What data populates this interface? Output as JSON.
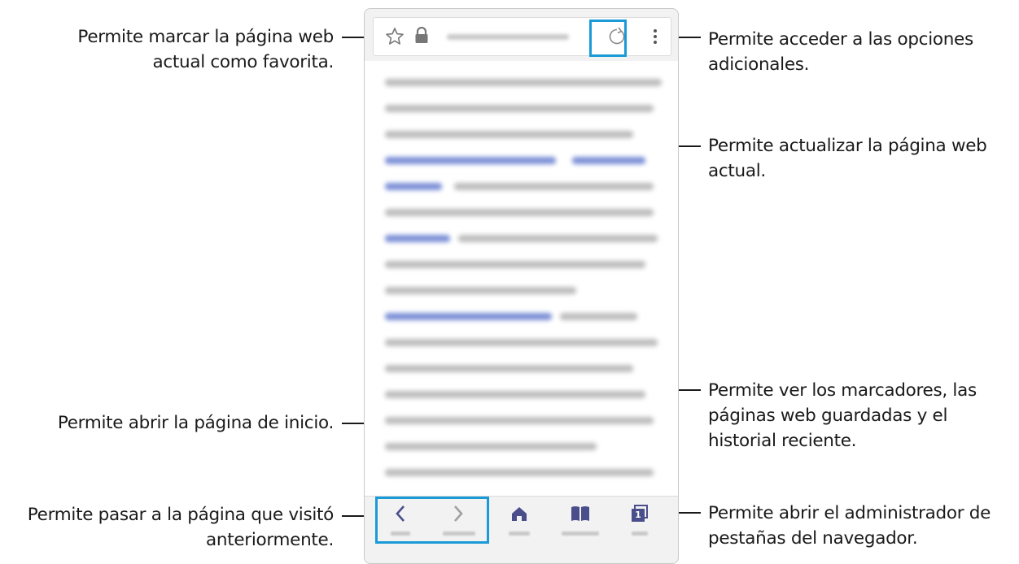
{
  "callouts": {
    "favorite": "Permite marcar la página web actual como favorita.",
    "options": "Permite acceder a las opciones adicionales.",
    "refresh": "Permite actualizar la página web actual.",
    "home": "Permite abrir la página de inicio.",
    "bookmarks": "Permite ver los marcadores, las páginas web guardadas y el historial reciente.",
    "back": "Permite pasar a la página que visitó anteriormente.",
    "tabs": "Permite abrir el administrador de pestañas del navegador."
  },
  "browser": {
    "tab_count": "1"
  },
  "icons": {
    "favorite": "star-icon",
    "secure": "lock-icon",
    "refresh": "refresh-icon",
    "menu": "more-vertical-icon",
    "back": "chevron-left-icon",
    "forward": "chevron-right-icon",
    "home": "home-icon",
    "bookmarks": "book-icon",
    "tabs": "tabs-icon"
  },
  "colors": {
    "highlight": "#1a9bd7",
    "icon": "#4a4f8c",
    "callout_text": "#1a1a1a"
  }
}
